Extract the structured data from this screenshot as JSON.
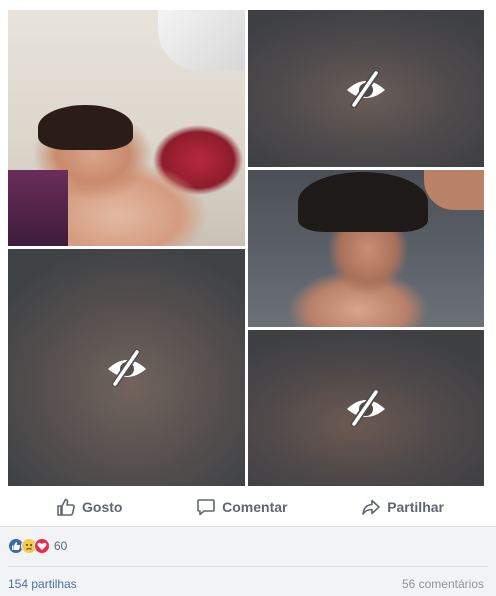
{
  "photo_grid": {
    "tiles": [
      {
        "kind": "photo"
      },
      {
        "kind": "hidden",
        "icon": "eye-slash-icon"
      },
      {
        "kind": "photo"
      },
      {
        "kind": "hidden",
        "icon": "eye-slash-icon"
      },
      {
        "kind": "hidden",
        "icon": "eye-slash-icon"
      }
    ]
  },
  "actions": {
    "like_label": "Gosto",
    "comment_label": "Comentar",
    "share_label": "Partilhar",
    "icons": [
      "thumbs-up-icon",
      "comment-bubble-icon",
      "share-arrow-icon"
    ]
  },
  "engagement": {
    "reaction_icons": [
      "like-reaction-icon",
      "sad-reaction-icon",
      "love-reaction-icon"
    ],
    "reaction_count": "60",
    "shares_text": "154 partilhas",
    "comments_text": "56 comentários"
  },
  "colors": {
    "action_text": "#606770",
    "link_blue": "#4b6fa8",
    "footer_bg": "#f2f3f5",
    "like_blue": "#4267b2",
    "love_red": "#f0284a",
    "sad_yellow": "#f7c948"
  }
}
